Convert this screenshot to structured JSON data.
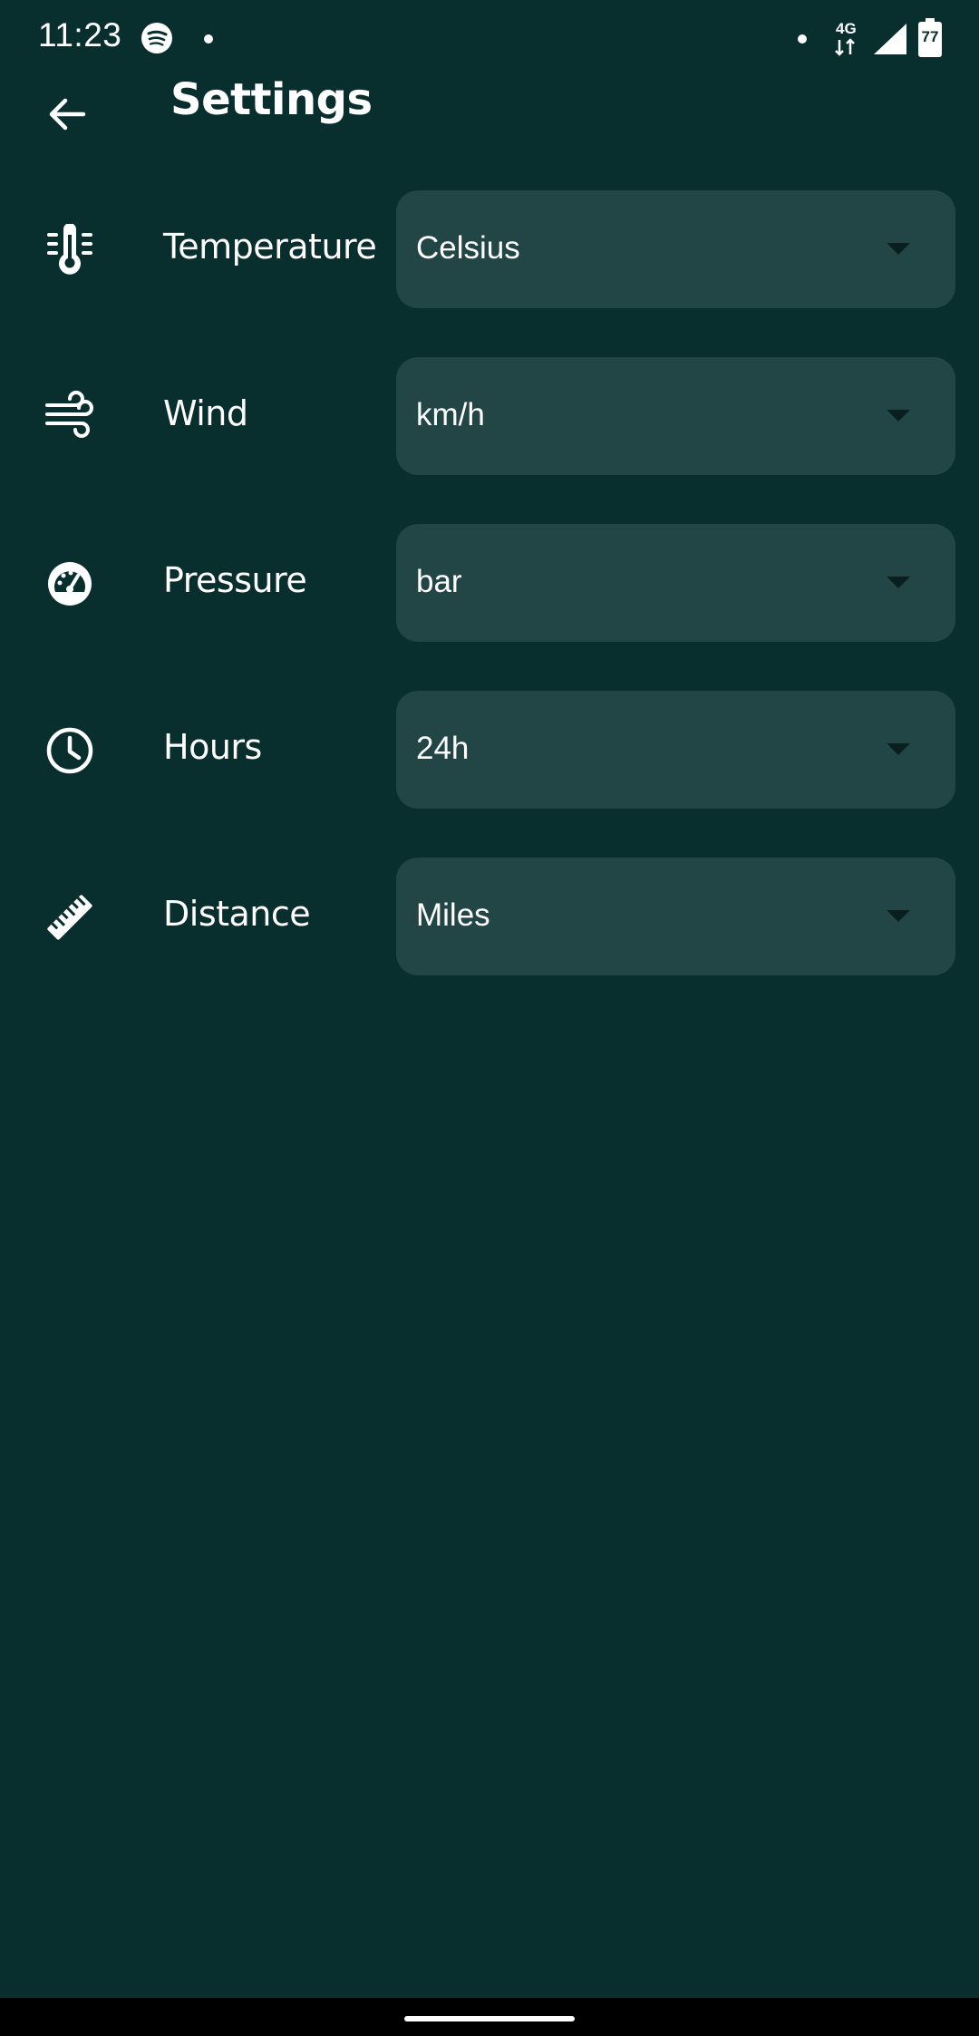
{
  "status_bar": {
    "time": "11:23",
    "network": "4G",
    "battery": "77",
    "icons": [
      "spotify-icon",
      "dot-icon",
      "network-4g-icon",
      "signal-icon",
      "battery-icon"
    ]
  },
  "app_bar": {
    "title": "Settings",
    "back_icon": "arrow-left-icon"
  },
  "settings": [
    {
      "label": "Temperature",
      "value": "Celsius",
      "icon": "thermometer-icon"
    },
    {
      "label": "Wind",
      "value": "km/h",
      "icon": "wind-icon"
    },
    {
      "label": "Pressure",
      "value": "bar",
      "icon": "gauge-icon"
    },
    {
      "label": "Hours",
      "value": "24h",
      "icon": "clock-icon"
    },
    {
      "label": "Distance",
      "value": "Miles",
      "icon": "ruler-icon"
    }
  ],
  "colors": {
    "background": "#082e2e",
    "dropdown_background": "#224646",
    "text": "#ffffff",
    "nav_bar": "#000000"
  }
}
